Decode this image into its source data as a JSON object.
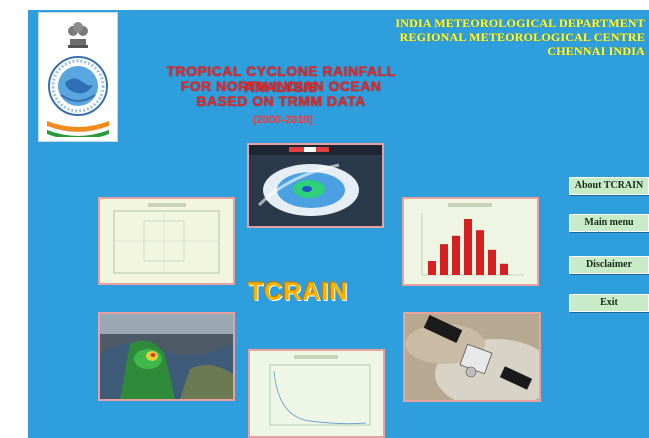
{
  "header": {
    "department_lines": [
      "INDIA METEOROLOGICAL DEPARTMENT",
      "REGIONAL METEOROLOGICAL CENTRE",
      "CHENNAI INDIA"
    ],
    "title_lines": [
      "TROPICAL CYCLONE RAINFALL ANALYSIS",
      "FOR NORTH INDIAN OCEAN",
      "BASED ON TRMM DATA"
    ],
    "period": "(2000-2010)"
  },
  "logo_text": "TCRAIN",
  "menu": {
    "about": "About  TCRAIN",
    "main_menu": "Main menu",
    "disclaimer": "Disclaimer",
    "exit": "Exit"
  },
  "bar_thumbnail": {
    "values": [
      0.25,
      0.55,
      0.7,
      1.0,
      0.8,
      0.45,
      0.2
    ]
  },
  "colors": {
    "background": "#2e9fdc",
    "header_text": "#ffff33",
    "title_text": "#e22a2a",
    "button_bg": "#c8ebc8",
    "bar_color": "#d42020"
  }
}
